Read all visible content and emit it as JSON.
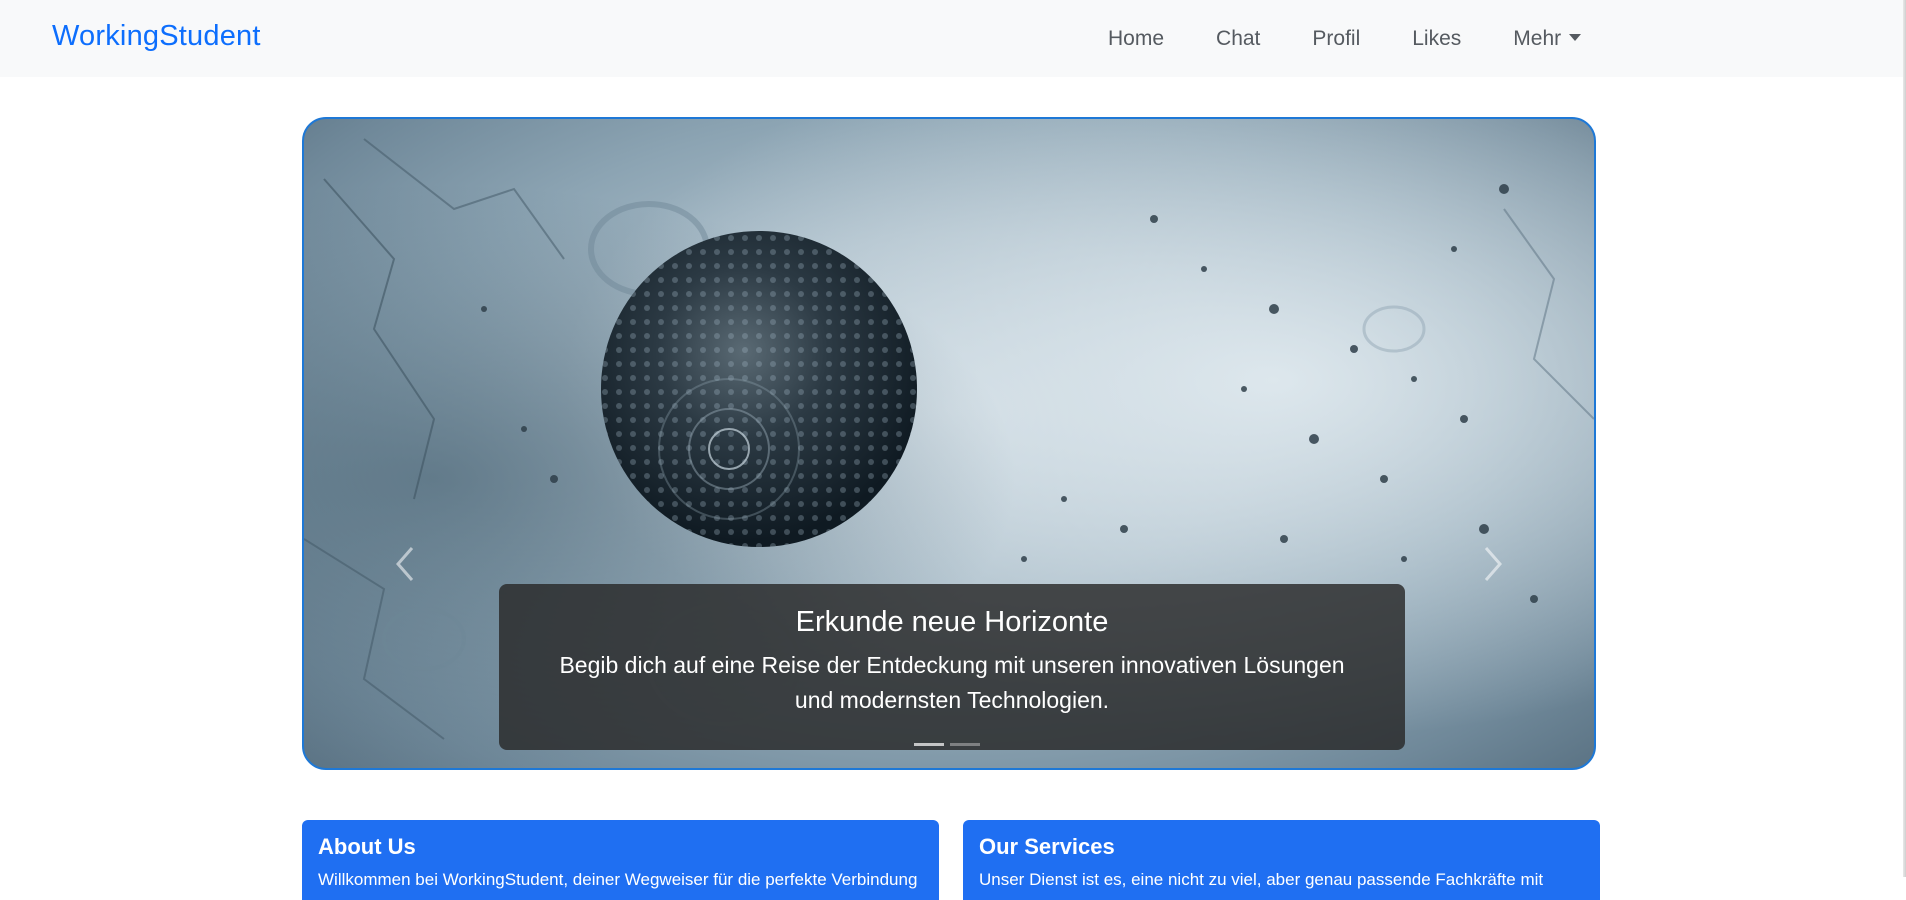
{
  "navbar": {
    "brand": "WorkingStudent",
    "links": [
      {
        "label": "Home"
      },
      {
        "label": "Chat"
      },
      {
        "label": "Profil"
      },
      {
        "label": "Likes"
      }
    ],
    "dropdown": {
      "label": "Mehr",
      "icon": "caret-down-icon"
    }
  },
  "carousel": {
    "caption_title": "Erkunde neue Horizonte",
    "caption_text": "Begib dich auf eine Reise der Entdeckung mit unseren innovativen Lösungen und modernsten Technologien.",
    "prev_icon": "chevron-left-icon",
    "next_icon": "chevron-right-icon",
    "slide_count": 2,
    "active_slide": 1
  },
  "cards": {
    "about": {
      "title": "About Us",
      "text": "Willkommen bei WorkingStudent, deiner Wegweiser für die perfekte Verbindung"
    },
    "services": {
      "title": "Our Services",
      "text": "Unser Dienst ist es, eine nicht zu viel, aber genau passende Fachkräfte mit"
    }
  },
  "colors": {
    "brand": "#0d6efd",
    "card_bg": "#1f6ff2",
    "carousel_border": "#1e78d6",
    "navbar_bg": "#f8f9fa"
  }
}
